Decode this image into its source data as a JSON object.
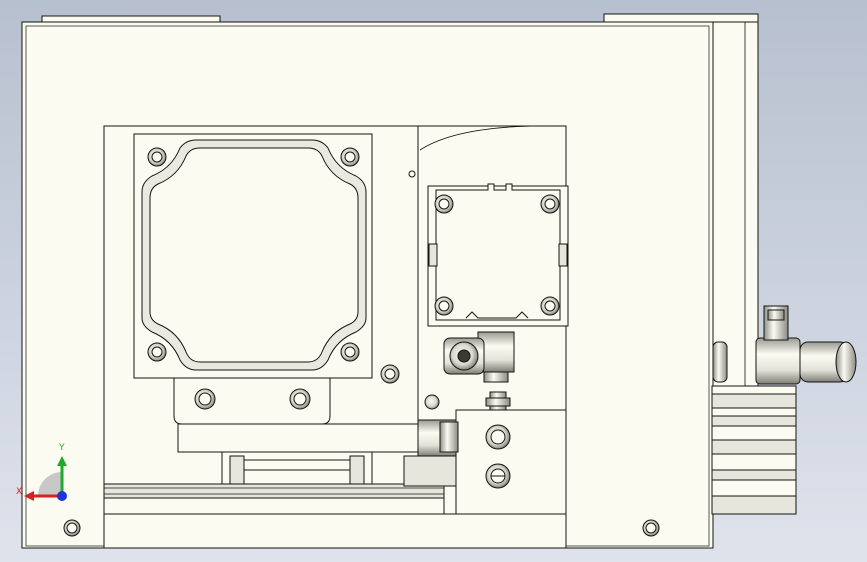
{
  "viewport": {
    "background_top": "#b7c0cf",
    "background_bottom": "#dfe3ec"
  },
  "part": {
    "face_color": "#fbfbf2",
    "shade_color": "#e6e6dd",
    "edge_color": "#141414",
    "mid_color": "#bdbdb4"
  },
  "triad": {
    "x_label": "X",
    "y_label": "Y",
    "x_color": "#d82020",
    "y_color": "#1faa2a",
    "z_color": "#1c35d8"
  }
}
